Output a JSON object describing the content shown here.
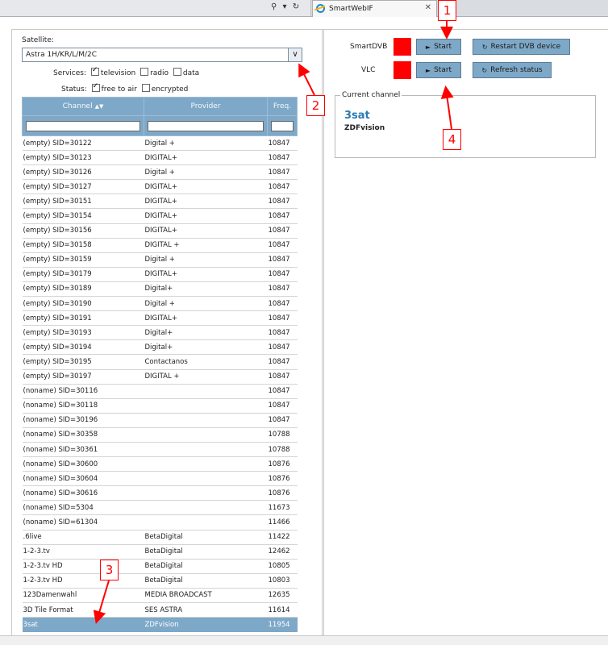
{
  "browser": {
    "tab_title": "SmartWebIF",
    "addr_icons": "⚲ ▾ ↻",
    "tab_close": "✕"
  },
  "left": {
    "satellite_label": "Satellite:",
    "satellite_value": "Astra 1H/KR/L/M/2C",
    "services_label": "Services:",
    "services": [
      {
        "label": "television",
        "checked": true
      },
      {
        "label": "radio",
        "checked": false
      },
      {
        "label": "data",
        "checked": false
      }
    ],
    "status_label": "Status:",
    "status": [
      {
        "label": "free to air",
        "checked": true
      },
      {
        "label": "encrypted",
        "checked": false
      }
    ],
    "table": {
      "headers": [
        "Channel",
        "Provider",
        "Freq."
      ],
      "rows": [
        [
          "(empty) SID=30122",
          "Digital +",
          "10847"
        ],
        [
          "(empty) SID=30123",
          "DIGITAL+",
          "10847"
        ],
        [
          "(empty) SID=30126",
          "Digital +",
          "10847"
        ],
        [
          "(empty) SID=30127",
          "DIGITAL+",
          "10847"
        ],
        [
          "(empty) SID=30151",
          "DIGITAL+",
          "10847"
        ],
        [
          "(empty) SID=30154",
          "DIGITAL+",
          "10847"
        ],
        [
          "(empty) SID=30156",
          "DIGITAL+",
          "10847"
        ],
        [
          "(empty) SID=30158",
          "DIGITAL +",
          "10847"
        ],
        [
          "(empty) SID=30159",
          "Digital +",
          "10847"
        ],
        [
          "(empty) SID=30179",
          "DIGITAL+",
          "10847"
        ],
        [
          "(empty) SID=30189",
          "Digital+",
          "10847"
        ],
        [
          "(empty) SID=30190",
          "Digital +",
          "10847"
        ],
        [
          "(empty) SID=30191",
          "DIGITAL+",
          "10847"
        ],
        [
          "(empty) SID=30193",
          "Digital+",
          "10847"
        ],
        [
          "(empty) SID=30194",
          "Digital+",
          "10847"
        ],
        [
          "(empty) SID=30195",
          "Contactanos",
          "10847"
        ],
        [
          "(empty) SID=30197",
          "DIGITAL +",
          "10847"
        ],
        [
          "(noname) SID=30116",
          "",
          "10847"
        ],
        [
          "(noname) SID=30118",
          "",
          "10847"
        ],
        [
          "(noname) SID=30196",
          "",
          "10847"
        ],
        [
          "(noname) SID=30358",
          "",
          "10788"
        ],
        [
          "(noname) SID=30361",
          "",
          "10788"
        ],
        [
          "(noname) SID=30600",
          "",
          "10876"
        ],
        [
          "(noname) SID=30604",
          "",
          "10876"
        ],
        [
          "(noname) SID=30616",
          "",
          "10876"
        ],
        [
          "(noname) SID=5304",
          "",
          "11673"
        ],
        [
          "(noname) SID=61304",
          "",
          "11466"
        ],
        [
          ".6live",
          "BetaDigital",
          "11422"
        ],
        [
          "1-2-3.tv",
          "BetaDigital",
          "12462"
        ],
        [
          "1-2-3.tv HD",
          "BetaDigital",
          "10805"
        ],
        [
          "1-2-3.tv HD",
          "BetaDigital",
          "10803"
        ],
        [
          "123Damenwahl",
          "MEDIA BROADCAST",
          "12635"
        ],
        [
          "3D Tile Format",
          "SES ASTRA",
          "11614"
        ],
        [
          "3sat",
          "ZDFvision",
          "11954"
        ]
      ],
      "selected_index": 33
    }
  },
  "right": {
    "smartdvb_label": "SmartDVB",
    "vlc_label": "VLC",
    "start_label": "Start",
    "restart_label": "Restart DVB device",
    "refresh_label": "Refresh status",
    "current_channel_legend": "Current channel",
    "current_channel_name": "3sat",
    "current_channel_provider": "ZDFvision",
    "status_color": "#ff0000",
    "accent_color": "#7ea8c8"
  },
  "annotations": [
    "1",
    "2",
    "3",
    "4"
  ]
}
